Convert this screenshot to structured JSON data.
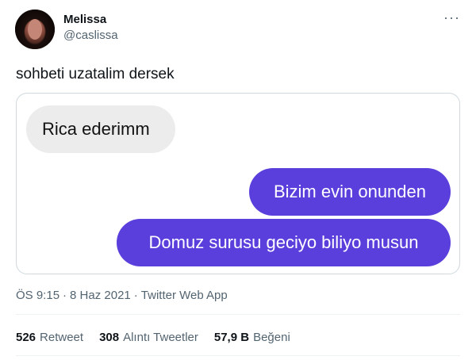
{
  "tweet": {
    "author_name": "Melissa",
    "author_handle": "@caslissa",
    "more_icon": "···",
    "text": "sohbeti uzatalim dersek",
    "media": {
      "incoming": "Rica ederimm",
      "outgoing": [
        "Bizim evin onunden",
        "Domuz surusu geciyo biliyo musun"
      ]
    },
    "time": "ÖS 9:15",
    "date": "8 Haz 2021",
    "source": "Twitter Web App",
    "separator": "·"
  },
  "stats": [
    {
      "count": "526",
      "label": "Retweet"
    },
    {
      "count": "308",
      "label": "Alıntı Tweetler"
    },
    {
      "count": "57,9 B",
      "label": "Beğeni"
    }
  ],
  "colors": {
    "outgoing_bubble": "#5b3fdc",
    "incoming_bubble": "#ececec",
    "secondary_text": "#536471"
  }
}
